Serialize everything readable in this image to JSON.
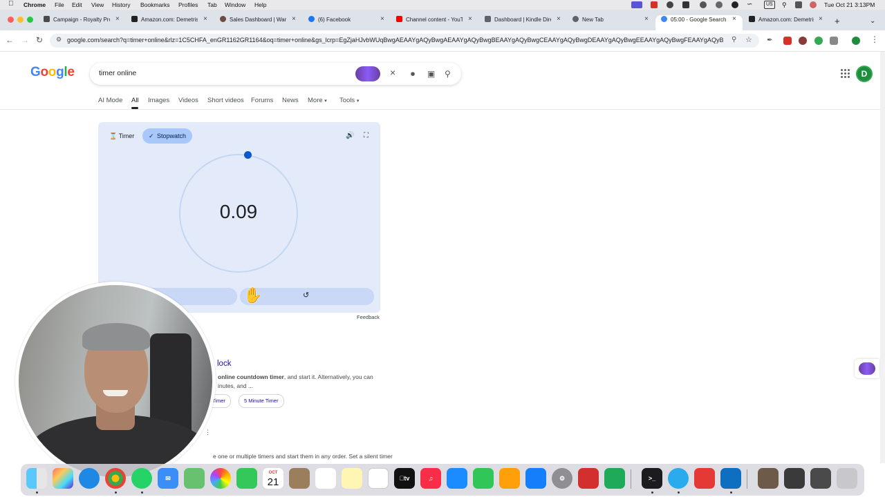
{
  "menubar": {
    "app": "Chrome",
    "items": [
      "File",
      "Edit",
      "View",
      "History",
      "Bookmarks",
      "Profiles",
      "Tab",
      "Window",
      "Help"
    ],
    "input_source": "US",
    "datetime": "Tue Oct 21  3:13PM"
  },
  "tabs": [
    {
      "title": "Campaign - Royalty Pro",
      "favicon": "royalty-icon",
      "color": "#4a4a4a"
    },
    {
      "title": "Amazon.com: Demetris",
      "favicon": "amazon-icon",
      "color": "#222222"
    },
    {
      "title": "Sales Dashboard | Warp",
      "favicon": "warp-icon",
      "color": "#6d4c41"
    },
    {
      "title": "(6) Facebook",
      "favicon": "facebook-icon",
      "color": "#1877f2"
    },
    {
      "title": "Channel content - YouTube",
      "favicon": "youtube-icon",
      "color": "#ff0000"
    },
    {
      "title": "Dashboard | Kindle Direct",
      "favicon": "kdp-icon",
      "color": "#5f6368"
    },
    {
      "title": "New Tab",
      "favicon": "chrome-icon",
      "color": "#5f6368"
    },
    {
      "title": "05:00 - Google Search",
      "favicon": "google-icon",
      "color": "#4285f4",
      "active": true
    },
    {
      "title": "Amazon.com: Demetris",
      "favicon": "amazon-icon",
      "color": "#222222"
    }
  ],
  "toolbar": {
    "url": "google.com/search?q=timer+online&rlz=1C5CHFA_enGR1162GR1164&oq=timer+online&gs_lcrp=EgZjaHJvbWUqBwgAEAAYgAQyBwgAEAAYgAQyBwgBEAAYgAQyBwgCEAAYgAQyBwgDEAAYgAQyBwgEEAAYgAQyBwgFEAAYgAQyB"
  },
  "google": {
    "logo": [
      "G",
      "o",
      "o",
      "g",
      "l",
      "e"
    ],
    "logo_colors": [
      "#4285f4",
      "#ea4335",
      "#fbbc05",
      "#4285f4",
      "#34a853",
      "#ea4335"
    ],
    "query": "timer online",
    "account_initial": "D"
  },
  "filters": [
    "AI Mode",
    "All",
    "Images",
    "Videos",
    "Short videos",
    "Forums",
    "News",
    "More",
    "Tools"
  ],
  "widget": {
    "mode_timer": "Timer",
    "mode_stopwatch": "Stopwatch",
    "display": "0.09",
    "feedback": "Feedback"
  },
  "results": {
    "title_fragment": "lock",
    "snippet_bold": "online countdown timer",
    "snippet_rest": ", and start it. Alternatively, you can",
    "snippet_line2": "inutes, and ...",
    "chips": [
      "Timer",
      "5 Minute Timer"
    ],
    "snippet2": "e one or multiple timers and start them in any order. Set a silent timer"
  },
  "dock": {
    "calendar_month": "OCT",
    "calendar_day": "21",
    "tv_label": "tv"
  }
}
